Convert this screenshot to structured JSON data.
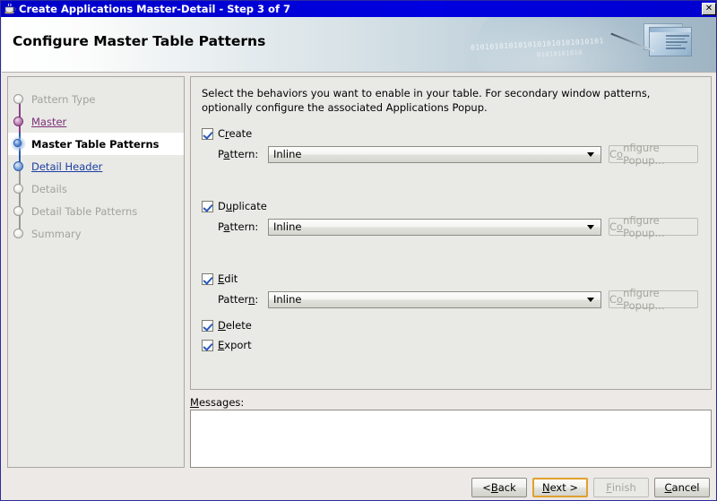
{
  "window": {
    "title": "Create Applications Master-Detail - Step 3 of 7",
    "icon": "java-cup-icon",
    "close_label": "✕"
  },
  "header": {
    "title": "Configure Master Table Patterns",
    "binary_line_1": "0101010101010101010101010101",
    "binary_line_2": "01010101010"
  },
  "sidebar": {
    "items": [
      {
        "label": "Pattern Type",
        "state": "disabled"
      },
      {
        "label": "Master",
        "state": "visited"
      },
      {
        "label": "Master Table Patterns",
        "state": "current"
      },
      {
        "label": "Detail Header",
        "state": "link"
      },
      {
        "label": "Details",
        "state": "disabled"
      },
      {
        "label": "Detail Table Patterns",
        "state": "disabled"
      },
      {
        "label": "Summary",
        "state": "disabled"
      }
    ]
  },
  "content": {
    "intro": "Select the behaviors you want to enable in your table.  For secondary window patterns, optionally configure the associated Applications Popup.",
    "groups": [
      {
        "checkbox_label_pre": "C",
        "checkbox_label_mnemonic": "r",
        "checkbox_label_post": "eate",
        "checkbox_label": "Create",
        "checked": true,
        "has_pattern": true,
        "pattern_label_pre": "P",
        "pattern_label_mnemonic": "a",
        "pattern_label_post": "ttern:",
        "pattern_value": "Inline",
        "popup_label_pre": "C",
        "popup_label_mnemonic": "o",
        "popup_label_post": "nfigure Popup...",
        "popup_enabled": false
      },
      {
        "checkbox_label_pre": "D",
        "checkbox_label_mnemonic": "u",
        "checkbox_label_post": "plicate",
        "checkbox_label": "Duplicate",
        "checked": true,
        "has_pattern": true,
        "pattern_label_pre": "P",
        "pattern_label_mnemonic": "a",
        "pattern_label_post": "ttern:",
        "pattern_value": "Inline",
        "popup_label_pre": "C",
        "popup_label_mnemonic": "o",
        "popup_label_post": "nfigure Popup...",
        "popup_enabled": false
      },
      {
        "checkbox_label_pre": "",
        "checkbox_label_mnemonic": "E",
        "checkbox_label_post": "dit",
        "checkbox_label": "Edit",
        "checked": true,
        "has_pattern": true,
        "pattern_label_pre": "Patter",
        "pattern_label_mnemonic": "n",
        "pattern_label_post": ":",
        "pattern_value": "Inline",
        "popup_label_pre": "C",
        "popup_label_mnemonic": "o",
        "popup_label_post": "nfigure Popup...",
        "popup_enabled": false
      }
    ],
    "simple_checkboxes": [
      {
        "label_pre": "",
        "label_mnemonic": "D",
        "label_post": "elete",
        "label": "Delete",
        "checked": true
      },
      {
        "label_pre": "",
        "label_mnemonic": "E",
        "label_post": "xport",
        "label": "Export",
        "checked": true
      }
    ]
  },
  "messages": {
    "label_pre": "",
    "label_mnemonic": "M",
    "label_post": "essages:",
    "label": "Messages:",
    "value": ""
  },
  "footer": {
    "buttons": [
      {
        "pre": "< ",
        "mnemonic": "B",
        "post": "ack",
        "label": "< Back",
        "state": "normal"
      },
      {
        "pre": "",
        "mnemonic": "N",
        "post": "ext >",
        "label": "Next >",
        "state": "focused"
      },
      {
        "pre": "",
        "mnemonic": "F",
        "post": "inish",
        "label": "Finish",
        "state": "disabled"
      },
      {
        "pre": "",
        "mnemonic": "C",
        "post": "ancel",
        "label": "Cancel",
        "state": "normal"
      }
    ]
  },
  "colors": {
    "titlebar": "#0000d0",
    "accent_focus": "#e0a030",
    "check_blue": "#2a58b8",
    "node_current": "#2f63b5",
    "node_visited": "#8e3f84",
    "panel_bg": "#e9e9e6"
  }
}
